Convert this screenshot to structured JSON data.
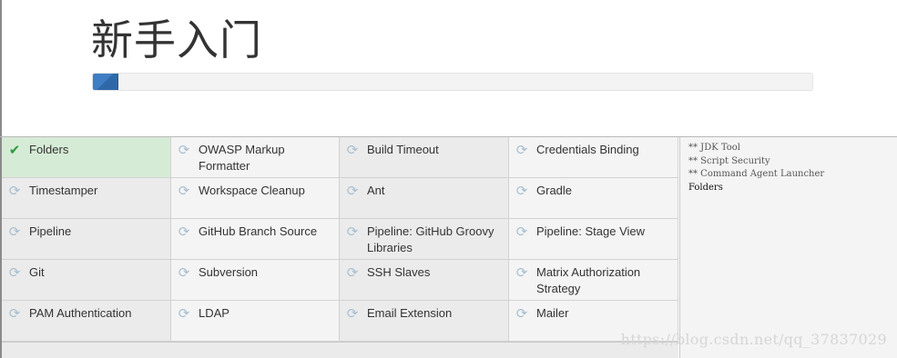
{
  "header": {
    "title": "新手入门",
    "progress_fraction": 0.034
  },
  "plugins": [
    {
      "label": "Folders",
      "status": "done",
      "icon": "check-icon"
    },
    {
      "label": "OWASP Markup Formatter",
      "status": "pending",
      "icon": "refresh-icon"
    },
    {
      "label": "Build Timeout",
      "status": "pending",
      "icon": "refresh-icon"
    },
    {
      "label": "Credentials Binding",
      "status": "pending",
      "icon": "refresh-icon"
    },
    {
      "label": "Timestamper",
      "status": "pending",
      "icon": "refresh-icon"
    },
    {
      "label": "Workspace Cleanup",
      "status": "pending",
      "icon": "refresh-icon"
    },
    {
      "label": "Ant",
      "status": "pending",
      "icon": "refresh-icon"
    },
    {
      "label": "Gradle",
      "status": "pending",
      "icon": "refresh-icon"
    },
    {
      "label": "Pipeline",
      "status": "pending",
      "icon": "refresh-icon"
    },
    {
      "label": "GitHub Branch Source",
      "status": "pending",
      "icon": "refresh-icon"
    },
    {
      "label": "Pipeline: GitHub Groovy Libraries",
      "status": "pending",
      "icon": "refresh-icon"
    },
    {
      "label": "Pipeline: Stage View",
      "status": "pending",
      "icon": "refresh-icon"
    },
    {
      "label": "Git",
      "status": "pending",
      "icon": "refresh-icon"
    },
    {
      "label": "Subversion",
      "status": "pending",
      "icon": "refresh-icon"
    },
    {
      "label": "SSH Slaves",
      "status": "pending",
      "icon": "refresh-icon"
    },
    {
      "label": "Matrix Authorization Strategy",
      "status": "pending",
      "icon": "refresh-icon"
    },
    {
      "label": "PAM Authentication",
      "status": "pending",
      "icon": "refresh-icon"
    },
    {
      "label": "LDAP",
      "status": "pending",
      "icon": "refresh-icon"
    },
    {
      "label": "Email Extension",
      "status": "pending",
      "icon": "refresh-icon"
    },
    {
      "label": "Mailer",
      "status": "pending",
      "icon": "refresh-icon"
    }
  ],
  "log": {
    "lines": [
      "** JDK Tool",
      "** Script Security",
      "** Command Agent Launcher",
      "Folders"
    ]
  },
  "watermark": "https://blog.csdn.net/qq_37837029",
  "colors": {
    "progress": "#3f7ec4",
    "done_bg": "#d6ebd6",
    "check": "#2e9a3f",
    "pending_icon": "#a8bfd0"
  }
}
